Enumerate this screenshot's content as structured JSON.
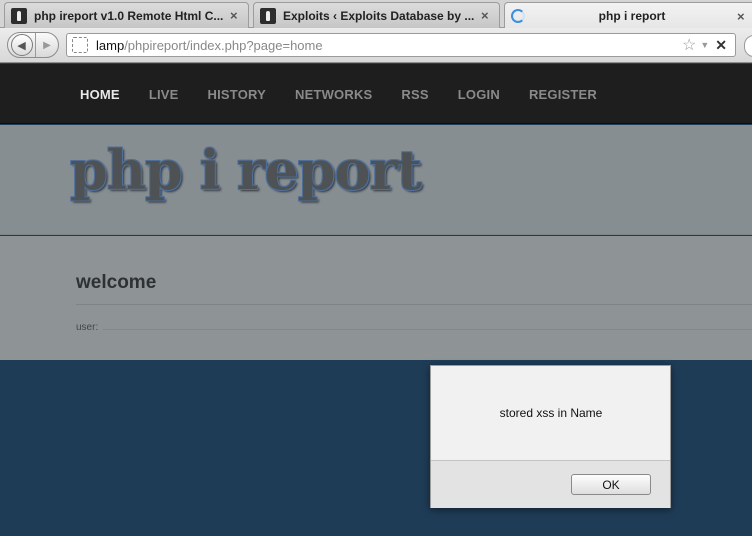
{
  "browser": {
    "tabs": [
      {
        "title": "php ireport v1.0 Remote Html C...",
        "active": false
      },
      {
        "title": "Exploits ‹ Exploits Database by ...",
        "active": false
      },
      {
        "title": "php i report",
        "active": true
      }
    ],
    "tab_close_glyph": "×",
    "url": {
      "host": "lamp",
      "path": "/phpireport/index.php?page=home"
    }
  },
  "site": {
    "nav": [
      {
        "label": "HOME",
        "current": true
      },
      {
        "label": "LIVE",
        "current": false
      },
      {
        "label": "HISTORY",
        "current": false
      },
      {
        "label": "NETWORKS",
        "current": false
      },
      {
        "label": "RSS",
        "current": false
      },
      {
        "label": "LOGIN",
        "current": false
      },
      {
        "label": "REGISTER",
        "current": false
      }
    ],
    "logo_text": "php i report",
    "heading": "welcome",
    "user_label": "user:"
  },
  "dialog": {
    "message": "stored xss in Name",
    "ok_label": "OK"
  },
  "colors": {
    "nav_bg": "#1e1e1e",
    "banner_bg": "#878e91",
    "page_bg": "#1f3d58",
    "logo_outline": "#4f6f99"
  }
}
